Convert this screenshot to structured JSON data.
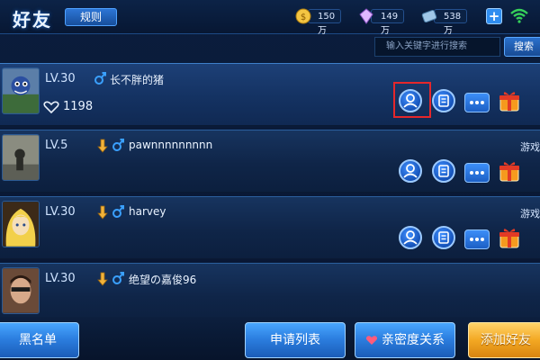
{
  "header": {
    "title": "好友",
    "tab_label": "规则",
    "currencies": [
      {
        "icon": "gold-coin-icon",
        "value": "150万",
        "color": "#f4c542"
      },
      {
        "icon": "diamond-icon",
        "value": "149万",
        "color": "#e0b7ff"
      },
      {
        "icon": "ticket-icon",
        "value": "538万",
        "color": "#9fc7e8"
      }
    ],
    "plus_label": "+"
  },
  "search": {
    "placeholder": "输入关键字进行搜索",
    "button_label": "搜索"
  },
  "friends": [
    {
      "level": "LV.30",
      "name": "长不胖的猪",
      "likes": "1198",
      "status": "",
      "gender": "male"
    },
    {
      "level": "LV.5",
      "name": "pawnnnnnnnnn",
      "likes": "",
      "status": "游戏",
      "gender": "male"
    },
    {
      "level": "LV.30",
      "name": "harvey",
      "likes": "",
      "status": "游戏",
      "gender": "male"
    },
    {
      "level": "LV.30",
      "name": "绝望の嘉俊96",
      "likes": "",
      "status": "",
      "gender": "male"
    }
  ],
  "footer": {
    "blacklist_label": "黑名单",
    "requests_label": "申请列表",
    "intimate_label": "亲密度关系",
    "add_friend_label": "添加好友"
  },
  "colors": {
    "accent_blue": "#2c7fe0",
    "accent_gold": "#f3a823",
    "highlight_red": "#e5272b",
    "gender_blue": "#3aa0ff"
  }
}
